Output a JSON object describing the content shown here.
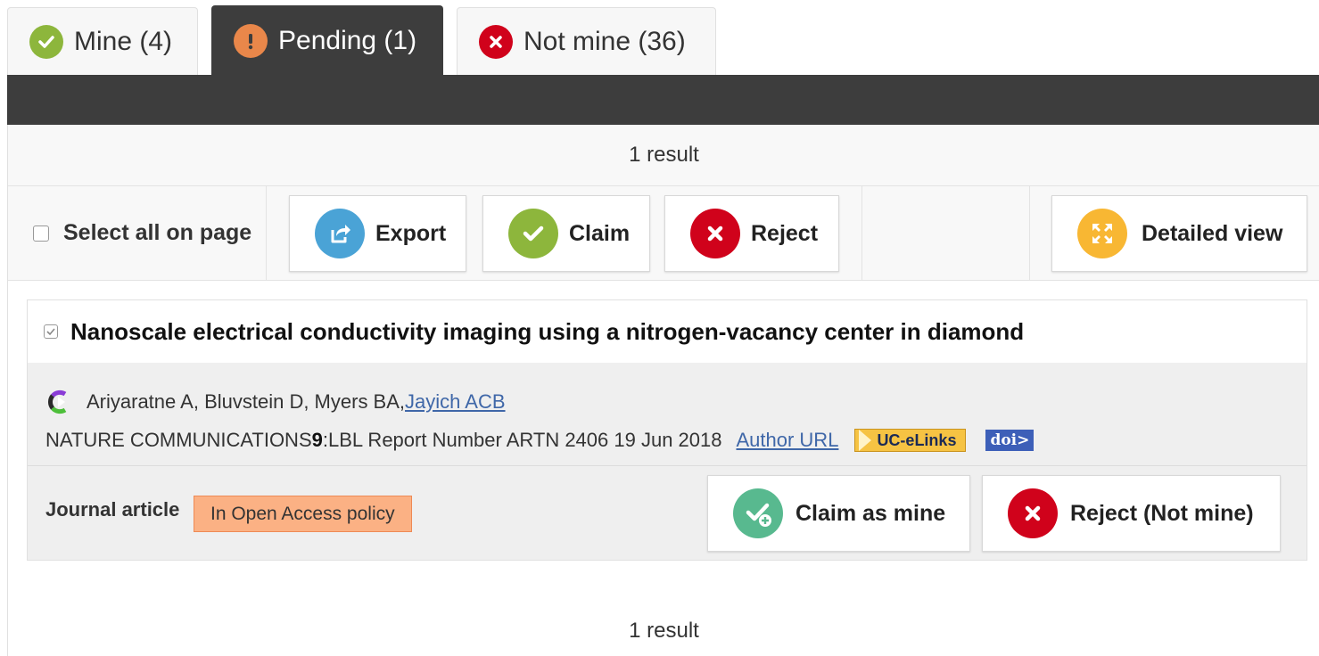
{
  "tabs": [
    {
      "label": "Mine (4)",
      "icon": "check-circle-icon",
      "color": "#8db63c"
    },
    {
      "label": "Pending (1)",
      "icon": "exclamation-circle-icon",
      "color": "#e9874a"
    },
    {
      "label": "Not mine (36)",
      "icon": "x-circle-icon",
      "color": "#d0021b"
    }
  ],
  "results": {
    "top": "1 result",
    "bottom": "1 result"
  },
  "toolbar": {
    "select_all_label": "Select all on page",
    "export_label": "Export",
    "claim_label": "Claim",
    "reject_label": "Reject",
    "detailed_view_label": "Detailed view"
  },
  "colors": {
    "export": "#4aa3d6",
    "claim": "#8db63c",
    "reject": "#d0021b",
    "detail": "#f8b733",
    "claim_mine": "#58b98f",
    "oa_badge": "#fbb184"
  },
  "publication": {
    "title": "Nanoscale electrical conductivity imaging using a nitrogen-vacancy center in diamond",
    "authors_plain": "Ariyaratne A, Bluvstein D, Myers BA, ",
    "author_link": "Jayich ACB",
    "journal_prefix": "NATURE COMMUNICATIONS ",
    "volume": "9",
    "journal_suffix": ":LBL Report Number ARTN 2406 19 Jun 2018",
    "author_url_label": "Author URL",
    "uc_elinks_label": "UC-eLinks",
    "doi_label": "doi>",
    "type": "Journal article",
    "oa_badge": "In Open Access policy",
    "claim_mine_label": "Claim as mine",
    "reject_not_mine_label": "Reject (Not mine)"
  }
}
